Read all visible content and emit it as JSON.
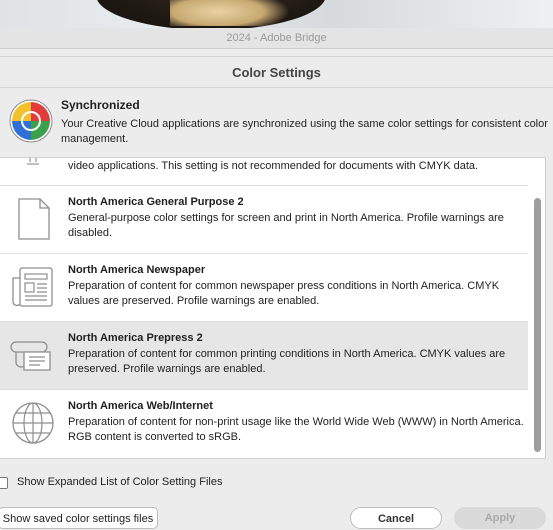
{
  "window": {
    "title": "2024 - Adobe Bridge"
  },
  "dialog": {
    "title": "Color Settings",
    "sync": {
      "title": "Synchronized",
      "description": "Your Creative Cloud applications are synchronized using the same color settings for consistent color management."
    },
    "list": {
      "partial_item_text": "video applications. This setting is not recommended for documents with CMYK data.",
      "items": [
        {
          "title": "North America General Purpose 2",
          "description": "General-purpose color settings for screen and print in North America. Profile warnings are disabled.",
          "icon": "document-icon"
        },
        {
          "title": "North America Newspaper",
          "description": "Preparation of content for common newspaper press conditions in North America. CMYK values are preserved. Profile warnings are enabled.",
          "icon": "newspaper-icon"
        },
        {
          "title": "North America Prepress 2",
          "description": "Preparation of content for common printing conditions in North America. CMYK values are preserved. Profile warnings are enabled.",
          "icon": "printing-press-icon",
          "selected": true
        },
        {
          "title": "North America Web/Internet",
          "description": "Preparation of content for non-print usage like the World Wide Web (WWW) in North America. RGB content is converted to sRGB.",
          "icon": "globe-icon"
        }
      ]
    },
    "expanded_list_label": "Show Expanded List of Color Setting Files",
    "expanded_list_checked": false,
    "buttons": {
      "saved": "Show saved color settings files",
      "cancel": "Cancel",
      "apply": "Apply"
    }
  }
}
